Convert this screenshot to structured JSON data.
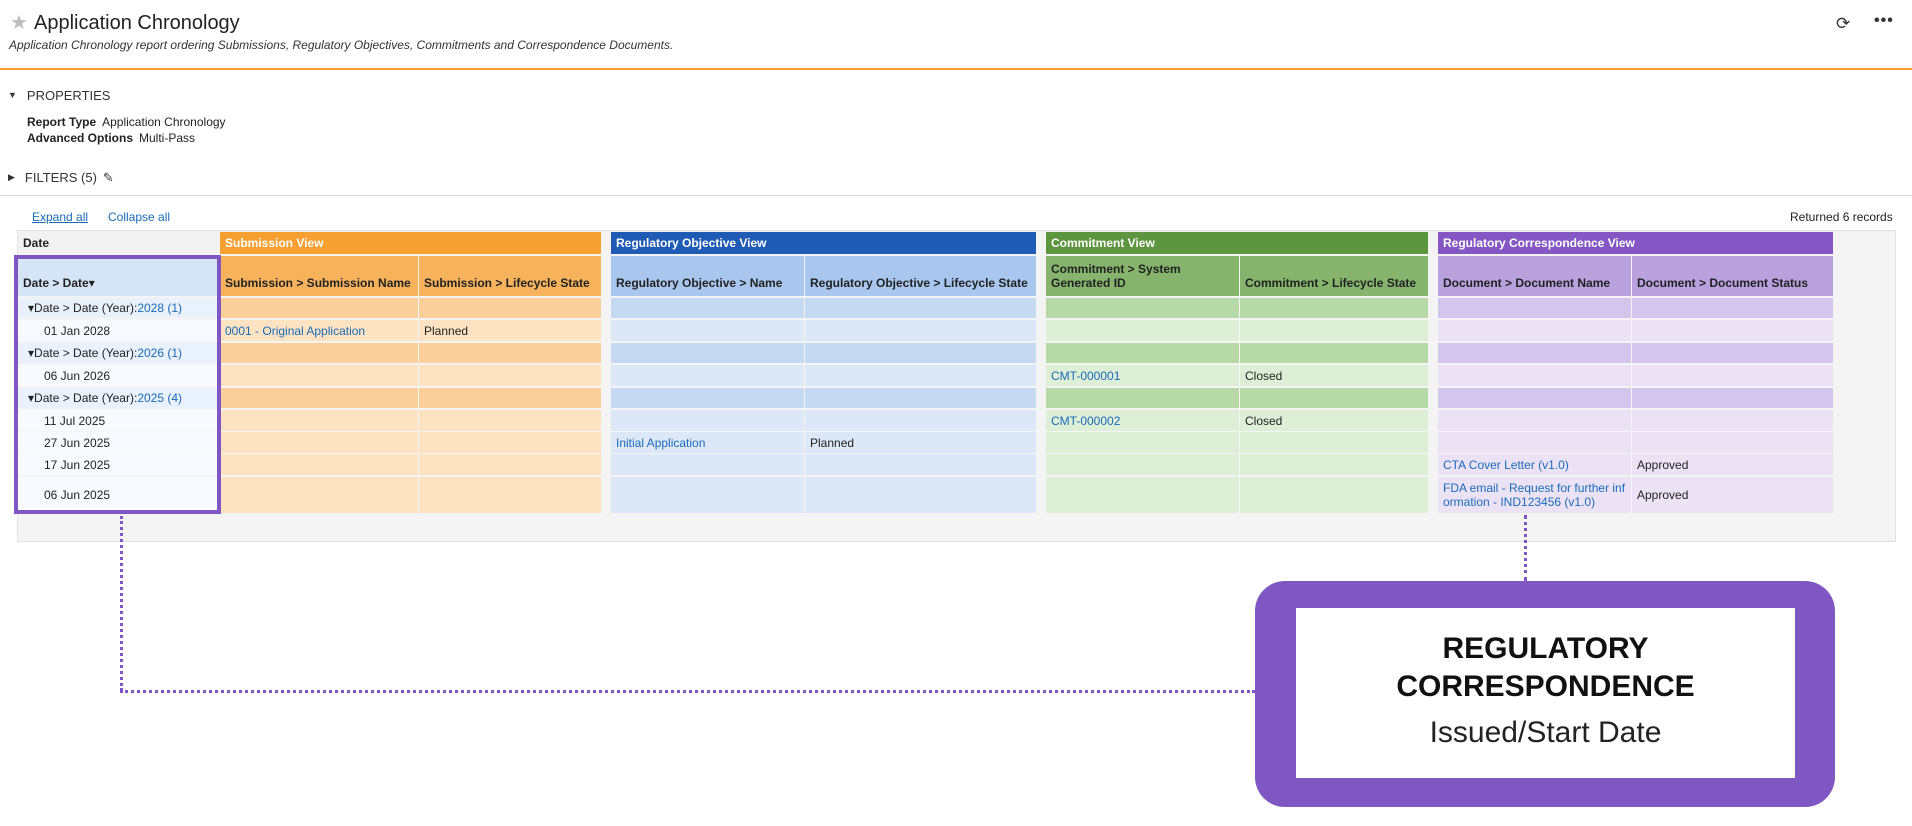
{
  "header": {
    "title": "Application Chronology",
    "subtitle": "Application Chronology report ordering Submissions, Regulatory Objectives, Commitments and Correspondence Documents.",
    "star_icon": "star-icon",
    "refresh_icon": "refresh-icon",
    "more_icon": "more-icon"
  },
  "properties": {
    "heading": "PROPERTIES",
    "report_type_label": "Report Type",
    "report_type_value": "Application Chronology",
    "advanced_label": "Advanced Options",
    "advanced_value": "Multi-Pass"
  },
  "filters": {
    "heading": "FILTERS (5)"
  },
  "toolbar": {
    "expand_all": "Expand all",
    "collapse_all": "Collapse all",
    "records": "Returned 6 records"
  },
  "groups": {
    "date": "Date",
    "submission": "Submission View",
    "objective": "Regulatory Objective View",
    "commitment": "Commitment View",
    "correspondence": "Regulatory Correspondence View"
  },
  "group_colors": {
    "submission_header": "#f5a030",
    "submission_light": "#fde3c2",
    "submission_group": "#fbcf9a",
    "objective_header": "#1f5bb5",
    "objective_light": "#dce8f8",
    "objective_group": "#c5d9f3",
    "commitment_header": "#5d963f",
    "commitment_light": "#ddefd6",
    "commitment_group": "#b6d9a7",
    "correspondence_header": "#8557c4",
    "correspondence_light": "#ebe3f5",
    "correspondence_group": "#d4c5ec"
  },
  "columns": {
    "date": "Date > Date",
    "sub_name": "Submission > Submission Name",
    "sub_state": "Submission > Lifecycle State",
    "obj_name": "Regulatory Objective > Name",
    "obj_state": "Regulatory Objective > Lifecycle State",
    "cmt_id": "Commitment > System Generated ID",
    "cmt_state": "Commitment > Lifecycle State",
    "doc_name": "Document > Document Name",
    "doc_status": "Document > Document Status"
  },
  "rows": [
    {
      "type": "group",
      "label": "Date > Date (Year):",
      "count_link": "2028 (1)"
    },
    {
      "type": "data",
      "date": "01 Jan 2028",
      "sub_name": "0001 - Original Application",
      "sub_state": "Planned",
      "obj_name": "",
      "obj_state": "",
      "cmt_id": "",
      "cmt_state": "",
      "doc_name": "",
      "doc_status": ""
    },
    {
      "type": "group",
      "label": "Date > Date (Year):",
      "count_link": "2026 (1)"
    },
    {
      "type": "data",
      "date": "06 Jun 2026",
      "sub_name": "",
      "sub_state": "",
      "obj_name": "",
      "obj_state": "",
      "cmt_id": "CMT-000001",
      "cmt_state": "Closed",
      "doc_name": "",
      "doc_status": ""
    },
    {
      "type": "group",
      "label": "Date > Date (Year):",
      "count_link": "2025 (4)"
    },
    {
      "type": "data",
      "date": "11 Jul 2025",
      "sub_name": "",
      "sub_state": "",
      "obj_name": "",
      "obj_state": "",
      "cmt_id": "CMT-000002",
      "cmt_state": "Closed",
      "doc_name": "",
      "doc_status": ""
    },
    {
      "type": "data",
      "date": "27 Jun 2025",
      "sub_name": "",
      "sub_state": "",
      "obj_name": "Initial Application",
      "obj_state": "Planned",
      "cmt_id": "",
      "cmt_state": "",
      "doc_name": "",
      "doc_status": ""
    },
    {
      "type": "data",
      "date": "17 Jun 2025",
      "sub_name": "",
      "sub_state": "",
      "obj_name": "",
      "obj_state": "",
      "cmt_id": "",
      "cmt_state": "",
      "doc_name": "CTA Cover Letter (v1.0)",
      "doc_status": "Approved"
    },
    {
      "type": "data",
      "date": "06 Jun 2025",
      "sub_name": "",
      "sub_state": "",
      "obj_name": "",
      "obj_state": "",
      "cmt_id": "",
      "cmt_state": "",
      "doc_name": "FDA email - Request for further information - IND123456 (v1.0)",
      "doc_status": "Approved"
    }
  ],
  "callout": {
    "line1": "REGULATORY",
    "line2": "CORRESPONDENCE",
    "line3": "Issued/Start Date"
  }
}
